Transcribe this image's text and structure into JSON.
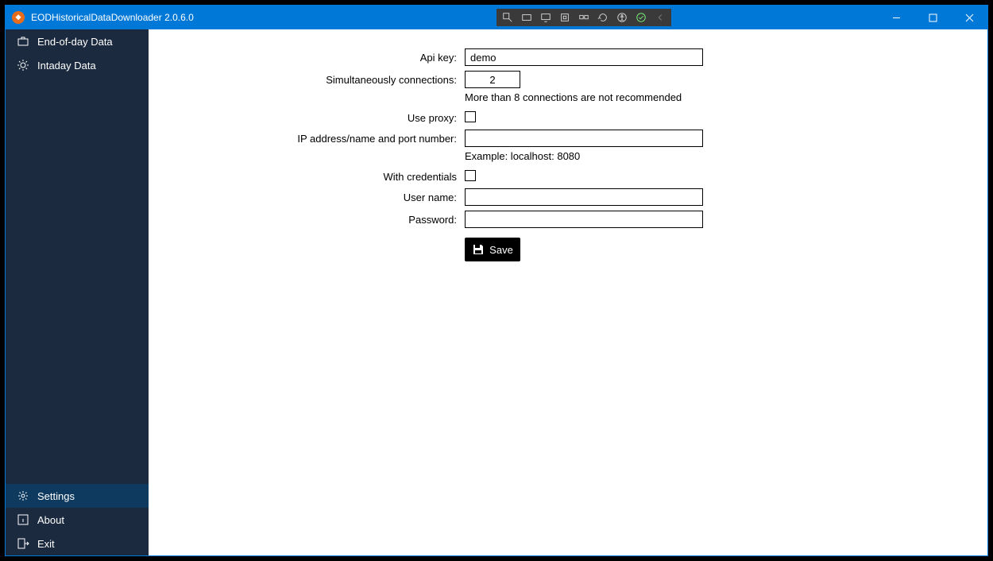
{
  "titlebar": {
    "title": "EODHistoricalDataDownloader 2.0.6.0"
  },
  "sidebar": {
    "top": [
      {
        "label": "End-of-day Data",
        "icon": "briefcase-icon"
      },
      {
        "label": "Intaday Data",
        "icon": "sun-icon"
      }
    ],
    "bottom": [
      {
        "label": "Settings",
        "icon": "gear-icon"
      },
      {
        "label": "About",
        "icon": "info-icon"
      },
      {
        "label": "Exit",
        "icon": "exit-icon"
      }
    ]
  },
  "form": {
    "api_key_label": "Api key:",
    "api_key_value": "demo",
    "conn_label": "Simultaneously connections:",
    "conn_value": "2",
    "conn_help": "More than 8 connections are not recommended",
    "use_proxy_label": "Use proxy:",
    "use_proxy_checked": false,
    "ip_label": "IP address/name and port number:",
    "ip_value": "",
    "ip_help": "Example: localhost: 8080",
    "with_cred_label": "With credentials",
    "with_cred_checked": false,
    "user_label": "User name:",
    "user_value": "",
    "pass_label": "Password:",
    "pass_value": "",
    "save_label": "Save"
  }
}
